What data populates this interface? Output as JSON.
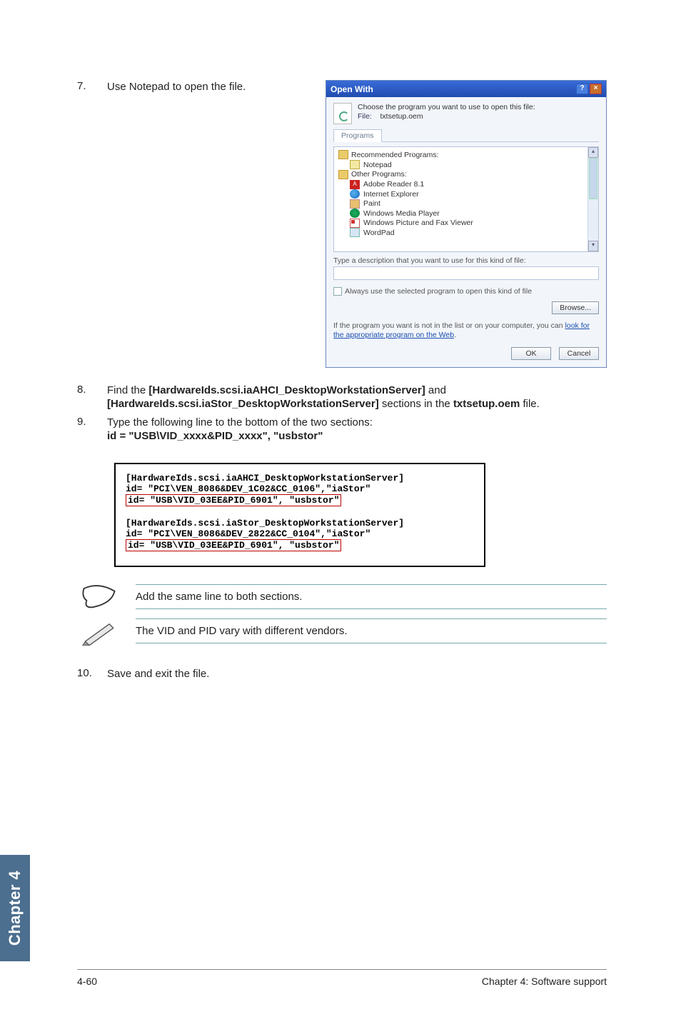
{
  "steps": {
    "s7": {
      "num": "7.",
      "text": "Use Notepad to open the file."
    },
    "s8": {
      "num": "8.",
      "line1_a": "Find the ",
      "line1_b": "[HardwareIds.scsi.iaAHCI_DesktopWorkstationServer]",
      "line1_c": " and",
      "line2_a": "[HardwareIds.scsi.iaStor_DesktopWorkstationServer]",
      "line2_b": " sections in the ",
      "line2_c": "txtsetup.oem",
      "line2_d": " file."
    },
    "s9": {
      "num": "9.",
      "line1": "Type the following line to the bottom of the two sections:",
      "line2": "id = \"USB\\VID_xxxx&PID_xxxx\", \"usbstor\""
    },
    "s10": {
      "num": "10.",
      "text": "Save and exit the file."
    }
  },
  "dialog": {
    "title": "Open With",
    "prompt": "Choose the program you want to use to open this file:",
    "file_label": "File:",
    "file_name": "txtsetup.oem",
    "tab": "Programs",
    "rec_header": "Recommended Programs:",
    "notepad": "Notepad",
    "other_header": "Other Programs:",
    "items": {
      "adobe": "Adobe Reader 8.1",
      "ie": "Internet Explorer",
      "paint": "Paint",
      "wmp": "Windows Media Player",
      "wpfv": "Windows Picture and Fax Viewer",
      "wordpad": "WordPad"
    },
    "desc_label": "Type a description that you want to use for this kind of file:",
    "check_label": "Always use the selected program to open this kind of file",
    "browse": "Browse...",
    "hint_a": "If the program you want is not in the list or on your computer, you can ",
    "hint_link": "look for the appropriate program on the Web",
    "hint_b": ".",
    "ok": "OK",
    "cancel": "Cancel"
  },
  "code": {
    "l1": "[HardwareIds.scsi.iaAHCI_DesktopWorkstationServer]",
    "l2": "id= \"PCI\\VEN_8086&DEV_1C02&CC_0106\",\"iaStor\"",
    "l3": "id= \"USB\\VID_03EE&PID_6901\", \"usbstor\"",
    "l4": "[HardwareIds.scsi.iaStor_DesktopWorkstationServer]",
    "l5": "id= \"PCI\\VEN_8086&DEV_2822&CC_0104\",\"iaStor\"",
    "l6": "id= \"USB\\VID_03EE&PID_6901\", \"usbstor\""
  },
  "notes": {
    "n1": "Add the same line to both sections.",
    "n2": "The VID and PID vary with different vendors."
  },
  "chapter_tab": "Chapter 4",
  "footer": {
    "left": "4-60",
    "right": "Chapter 4: Software support"
  }
}
